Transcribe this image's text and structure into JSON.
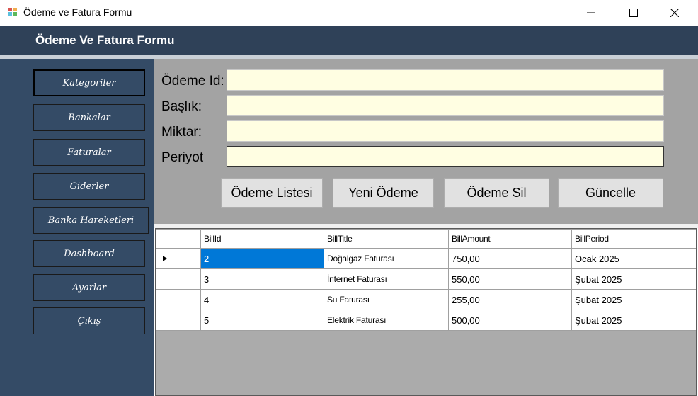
{
  "window": {
    "title": "Ödeme ve Fatura Formu"
  },
  "header": {
    "title": "Ödeme Ve Fatura Formu"
  },
  "sidebar": {
    "items": [
      {
        "label": "Kategoriler"
      },
      {
        "label": "Bankalar"
      },
      {
        "label": "Faturalar"
      },
      {
        "label": "Giderler"
      },
      {
        "label": "Banka Hareketleri"
      },
      {
        "label": "Dashboard"
      },
      {
        "label": "Ayarlar"
      },
      {
        "label": "Çıkış"
      }
    ]
  },
  "form": {
    "id_label": "Ödeme Id:",
    "title_label": "Başlık:",
    "amount_label": "Miktar:",
    "period_label": "Periyot",
    "id_value": "",
    "title_value": "",
    "amount_value": "",
    "period_value": ""
  },
  "actions": {
    "list_label": "Ödeme Listesi",
    "new_label": "Yeni Ödeme",
    "delete_label": "Ödeme Sil",
    "update_label": "Güncelle"
  },
  "grid": {
    "columns": [
      "BillId",
      "BillTitle",
      "BillAmount",
      "BillPeriod"
    ],
    "rows": [
      [
        "2",
        "Doğalgaz Faturası",
        "750,00",
        "Ocak 2025"
      ],
      [
        "3",
        "İnternet Faturası",
        "550,00",
        "Şubat 2025"
      ],
      [
        "4",
        "Su Faturası",
        "255,00",
        "Şubat 2025"
      ],
      [
        "5",
        "Elektrik Faturası",
        "500,00",
        "Şubat 2025"
      ]
    ]
  },
  "colors": {
    "header_bg": "#2f4158",
    "sidebar_bg": "#344b66",
    "form_bg": "#a3a3a3",
    "input_bg": "#fffee2",
    "selection": "#0078d7"
  }
}
